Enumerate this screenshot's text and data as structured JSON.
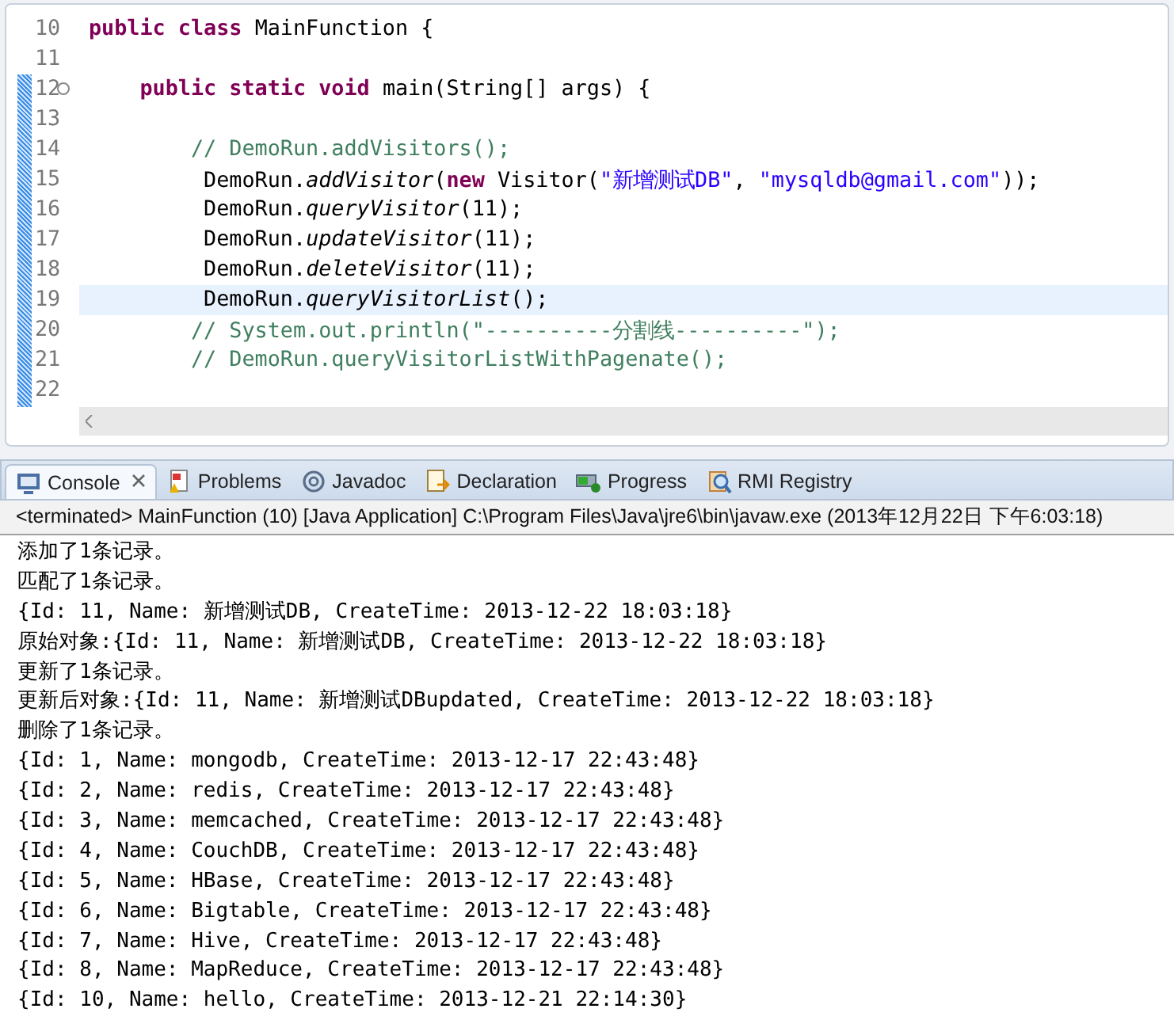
{
  "editor": {
    "lines": [
      {
        "number": "10",
        "current": false,
        "tokens": [
          {
            "kind": "keyword",
            "text": "public class "
          },
          {
            "kind": "plain",
            "text": "MainFunction {"
          }
        ]
      },
      {
        "number": "11",
        "current": false
      },
      {
        "number": "12",
        "current": false,
        "fold": true,
        "tokens": [
          {
            "kind": "keyword",
            "text": "    public static void "
          },
          {
            "kind": "plain",
            "text": "main(String[] args) {"
          }
        ]
      },
      {
        "number": "13",
        "current": false
      },
      {
        "number": "14",
        "current": false,
        "tokens": [
          {
            "kind": "comment",
            "text": "        // DemoRun.addVisitors();"
          }
        ]
      },
      {
        "number": "15",
        "current": false,
        "tokens": [
          {
            "kind": "plain",
            "text": "         DemoRun."
          },
          {
            "kind": "method",
            "text": "addVisitor"
          },
          {
            "kind": "plain",
            "text": "("
          },
          {
            "kind": "keyword",
            "text": "new "
          },
          {
            "kind": "plain",
            "text": "Visitor("
          },
          {
            "kind": "string",
            "text": "\"新增测试DB\""
          },
          {
            "kind": "plain",
            "text": ", "
          },
          {
            "kind": "string",
            "text": "\"mysqldb@gmail.com\""
          },
          {
            "kind": "plain",
            "text": "));"
          }
        ]
      },
      {
        "number": "16",
        "current": false,
        "tokens": [
          {
            "kind": "plain",
            "text": "         DemoRun."
          },
          {
            "kind": "method",
            "text": "queryVisitor"
          },
          {
            "kind": "plain",
            "text": "(11);"
          }
        ]
      },
      {
        "number": "17",
        "current": false,
        "tokens": [
          {
            "kind": "plain",
            "text": "         DemoRun."
          },
          {
            "kind": "method",
            "text": "updateVisitor"
          },
          {
            "kind": "plain",
            "text": "(11);"
          }
        ]
      },
      {
        "number": "18",
        "current": false,
        "tokens": [
          {
            "kind": "plain",
            "text": "         DemoRun."
          },
          {
            "kind": "method",
            "text": "deleteVisitor"
          },
          {
            "kind": "plain",
            "text": "(11);"
          }
        ]
      },
      {
        "number": "19",
        "current": true,
        "tokens": [
          {
            "kind": "plain",
            "text": "         DemoRun."
          },
          {
            "kind": "method",
            "text": "queryVisitorList"
          },
          {
            "kind": "plain",
            "text": "();"
          }
        ]
      },
      {
        "number": "20",
        "current": false,
        "tokens": [
          {
            "kind": "comment",
            "text": "        // System.out.println(\"----------分割线----------\");"
          }
        ]
      },
      {
        "number": "21",
        "current": false,
        "tokens": [
          {
            "kind": "comment",
            "text": "        // DemoRun.queryVisitorListWithPagenate();"
          }
        ]
      },
      {
        "number": "22",
        "current": false
      }
    ]
  },
  "tabs": [
    {
      "label": "Console",
      "selected": true,
      "closable": true
    },
    {
      "label": "Problems",
      "selected": false
    },
    {
      "label": "Javadoc",
      "selected": false
    },
    {
      "label": "Declaration",
      "selected": false
    },
    {
      "label": "Progress",
      "selected": false
    },
    {
      "label": "RMI Registry",
      "selected": false
    }
  ],
  "console": {
    "status": "<terminated> MainFunction (10) [Java Application] C:\\Program Files\\Java\\jre6\\bin\\javaw.exe (2013年12月22日 下午6:03:18)",
    "output": [
      "添加了1条记录。",
      "匹配了1条记录。",
      "{Id: 11, Name: 新增测试DB, CreateTime: 2013-12-22 18:03:18}",
      "原始对象:{Id: 11, Name: 新增测试DB, CreateTime: 2013-12-22 18:03:18}",
      "更新了1条记录。",
      "更新后对象:{Id: 11, Name: 新增测试DBupdated, CreateTime: 2013-12-22 18:03:18}",
      "删除了1条记录。",
      "{Id: 1, Name: mongodb, CreateTime: 2013-12-17 22:43:48}",
      "{Id: 2, Name: redis, CreateTime: 2013-12-17 22:43:48}",
      "{Id: 3, Name: memcached, CreateTime: 2013-12-17 22:43:48}",
      "{Id: 4, Name: CouchDB, CreateTime: 2013-12-17 22:43:48}",
      "{Id: 5, Name: HBase, CreateTime: 2013-12-17 22:43:48}",
      "{Id: 6, Name: Bigtable, CreateTime: 2013-12-17 22:43:48}",
      "{Id: 7, Name: Hive, CreateTime: 2013-12-17 22:43:48}",
      "{Id: 8, Name: MapReduce, CreateTime: 2013-12-17 22:43:48}",
      "{Id: 10, Name: hello, CreateTime: 2013-12-21 22:14:30}"
    ]
  }
}
